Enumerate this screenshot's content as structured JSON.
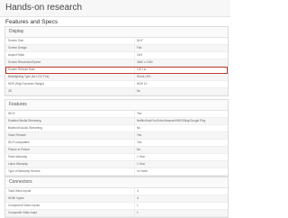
{
  "page": {
    "title": "Hands-on research"
  },
  "section": {
    "title": "Features and Specs"
  },
  "display": {
    "header": "Display",
    "rows": [
      {
        "label": "Screen Size",
        "value": "64.5\""
      },
      {
        "label": "Screen Design",
        "value": "Flat"
      },
      {
        "label": "Aspect Ratio",
        "value": "16:9"
      },
      {
        "label": "Screen Resolution/Speed",
        "value": "3840 x 2160"
      },
      {
        "label": "Screen Refresh Rate",
        "value": "120 Hz",
        "highlighted": true
      },
      {
        "label": "Backlighting Type (for LCD TVs)",
        "value": "Direct LED"
      },
      {
        "label": "HDR (High Dynamic Range)",
        "value": "HDR 10"
      },
      {
        "label": "3D",
        "value": "No"
      }
    ]
  },
  "features": {
    "header": "Features",
    "rows": [
      {
        "label": "Wi-Fi",
        "value": "Yes"
      },
      {
        "label": "Enabled Media Streaming",
        "value": "Netflix/Hulu/YouTube/Amazon/HBO/Sling/Google Play"
      },
      {
        "label": "Bluetooth Audio Streaming",
        "value": "No"
      },
      {
        "label": "Voice Remote",
        "value": "Yes"
      },
      {
        "label": "Wi-Fi compatible",
        "value": "Yes"
      },
      {
        "label": "Picture in Picture",
        "value": "No"
      },
      {
        "label": "Parts Warranty",
        "value": "1 Year"
      },
      {
        "label": "Labor Warranty",
        "value": "1 Year"
      },
      {
        "label": "Type of Warranty Service",
        "value": "In Home"
      }
    ]
  },
  "connectors": {
    "header": "Connectors",
    "rows": [
      {
        "label": "Total Video Inputs",
        "value": "4"
      },
      {
        "label": "HDMI Inputs",
        "value": "4"
      },
      {
        "label": "Component Video Inputs",
        "value": "1"
      },
      {
        "label": "Composite Video Input",
        "value": "1"
      }
    ]
  }
}
